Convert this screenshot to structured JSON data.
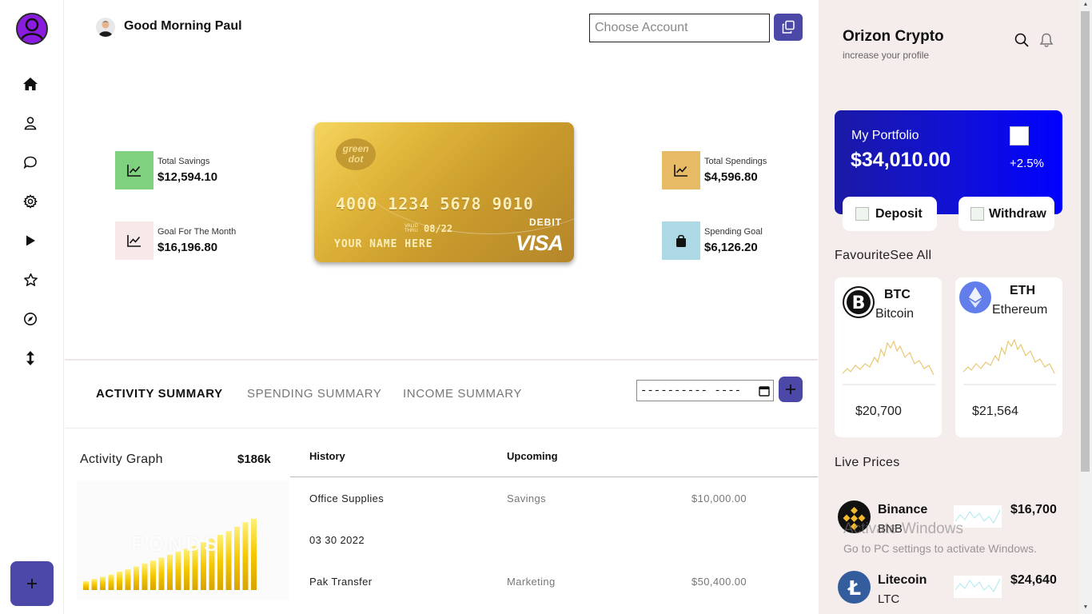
{
  "header": {
    "greeting": "Good Morning Paul",
    "account_placeholder": "Choose Account"
  },
  "stats": {
    "total_savings": {
      "label": "Total Savings",
      "value": "$12,594.10",
      "color": "#7fd07f"
    },
    "goal_month": {
      "label": "Goal For The Month",
      "value": "$16,196.80",
      "color": "#f7e9e9"
    },
    "total_spendings": {
      "label": "Total Spendings",
      "value": "$4,596.80",
      "color": "#e7ba66"
    },
    "spending_goal": {
      "label": "Spending Goal",
      "value": "$6,126.20",
      "color": "#add8e6"
    }
  },
  "card": {
    "brand": "green dot",
    "number": "4000 1234 5678 9010",
    "valid_label": "VALID THRU",
    "expiry": "08/22",
    "holder": "YOUR NAME HERE",
    "type": "DEBIT",
    "network": "VISA"
  },
  "tabs": [
    {
      "label": "ACTIVITY SUMMARY",
      "active": true
    },
    {
      "label": "SPENDING SUMMARY",
      "active": false
    },
    {
      "label": "INCOME SUMMARY",
      "active": false
    }
  ],
  "date_field": {
    "value": "---------- ----"
  },
  "activity": {
    "title": "Activity Graph",
    "total": "$186k",
    "watermark": "PONDS",
    "bar_levels": [
      0.12,
      0.15,
      0.18,
      0.21,
      0.25,
      0.28,
      0.32,
      0.36,
      0.4,
      0.44,
      0.48,
      0.52,
      0.56,
      0.6,
      0.65,
      0.7,
      0.75,
      0.8,
      0.86,
      0.92,
      0.97
    ]
  },
  "history": {
    "col_history": "History",
    "col_upcoming": "Upcoming",
    "rows": [
      {
        "name": "Office Supplies",
        "category": "Savings",
        "amount": "$10,000.00"
      },
      {
        "name": "03 30 2022",
        "category": "",
        "amount": ""
      },
      {
        "name": "Pak Transfer",
        "category": "Marketing",
        "amount": "$50,400.00"
      }
    ]
  },
  "panel": {
    "title": "Orizon Crypto",
    "subtitle": "increase your profile",
    "portfolio": {
      "label": "My Portfolio",
      "amount": "$34,010.00",
      "change": "+2.5%",
      "deposit": "Deposit",
      "withdraw": "Withdraw"
    },
    "favourite_label": "Favourite",
    "see_all": "See All",
    "favourites": [
      {
        "symbol": "BTC",
        "name": "Bitcoin",
        "price": "$20,700",
        "color": "#111111"
      },
      {
        "symbol": "ETH",
        "name": "Ethereum",
        "price": "$21,564",
        "color": "#627eea"
      }
    ],
    "live_label": "Live Prices",
    "live": [
      {
        "name": "Binance",
        "ticker": "BNB",
        "price": "$16,700",
        "color": "#f3ba2f"
      },
      {
        "name": "Litecoin",
        "ticker": "LTC",
        "price": "$24,640",
        "color": "#345d9d"
      }
    ]
  },
  "watermark": {
    "line1": "Activate Windows",
    "line2": "Go to PC settings to activate Windows."
  },
  "colors": {
    "accent": "#4b48a8",
    "panel_bg": "#f5ecec",
    "portfolio": "#1010d8"
  }
}
